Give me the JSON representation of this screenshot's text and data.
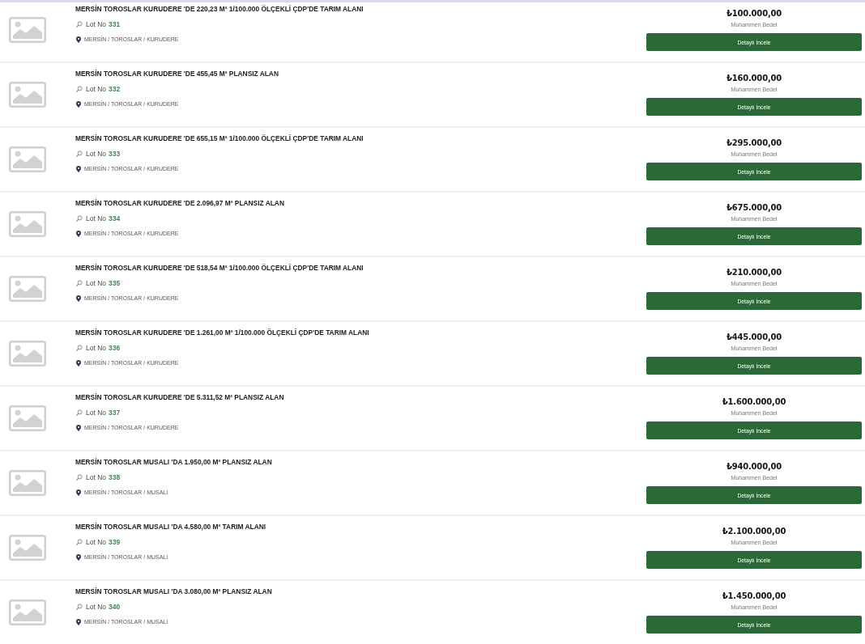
{
  "listings": [
    {
      "title": "MERSİN TOROSLAR KURUDERE 'DE 220,23 M² 1/100.000 ÖLÇEKLİ ÇDP'DE TARIM ALANI",
      "lot_label": "Lot No",
      "lot_number": "331",
      "location": "MERSİN / TOROSLAR / KURUDERE",
      "price": "₺100.000,00",
      "price_label": "Muhammen Bedel",
      "button": "Detaylı İncele"
    },
    {
      "title": "MERSİN TOROSLAR KURUDERE 'DE 455,45 M² PLANSIZ ALAN",
      "lot_label": "Lot No",
      "lot_number": "332",
      "location": "MERSİN / TOROSLAR / KURUDERE",
      "price": "₺160.000,00",
      "price_label": "Muhammen Bedel",
      "button": "Detaylı İncele"
    },
    {
      "title": "MERSİN TOROSLAR KURUDERE 'DE 655,15 M² 1/100.000 ÖLÇEKLİ ÇDP'DE TARIM ALANI",
      "lot_label": "Lot No",
      "lot_number": "333",
      "location": "MERSİN / TOROSLAR / KURUDERE",
      "price": "₺295.000,00",
      "price_label": "Muhammen Bedel",
      "button": "Detaylı İncele"
    },
    {
      "title": "MERSİN TOROSLAR KURUDERE 'DE 2.096,97 M² PLANSIZ ALAN",
      "lot_label": "Lot No",
      "lot_number": "334",
      "location": "MERSİN / TOROSLAR / KURUDERE",
      "price": "₺675.000,00",
      "price_label": "Muhammen Bedel",
      "button": "Detaylı İncele"
    },
    {
      "title": "MERSİN TOROSLAR KURUDERE 'DE 518,54 M² 1/100.000 ÖLÇEKLİ ÇDP'DE TARIM ALANI",
      "lot_label": "Lot No",
      "lot_number": "335",
      "location": "MERSİN / TOROSLAR / KURUDERE",
      "price": "₺210.000,00",
      "price_label": "Muhammen Bedel",
      "button": "Detaylı İncele"
    },
    {
      "title": "MERSİN TOROSLAR KURUDERE 'DE 1.261,00 M² 1/100.000 ÖLÇEKLİ ÇDP'DE TARIM ALANI",
      "lot_label": "Lot No",
      "lot_number": "336",
      "location": "MERSİN / TOROSLAR / KURUDERE",
      "price": "₺445.000,00",
      "price_label": "Muhammen Bedel",
      "button": "Detaylı İncele"
    },
    {
      "title": "MERSİN TOROSLAR KURUDERE 'DE 5.311,52 M² PLANSIZ ALAN",
      "lot_label": "Lot No",
      "lot_number": "337",
      "location": "MERSİN / TOROSLAR / KURUDERE",
      "price": "₺1.600.000,00",
      "price_label": "Muhammen Bedel",
      "button": "Detaylı İncele"
    },
    {
      "title": "MERSİN TOROSLAR MUSALI 'DA 1.950,00 M² PLANSIZ ALAN",
      "lot_label": "Lot No",
      "lot_number": "338",
      "location": "MERSİN / TOROSLAR / MUSALI",
      "price": "₺940.000,00",
      "price_label": "Muhammen Bedel",
      "button": "Detaylı İncele"
    },
    {
      "title": "MERSİN TOROSLAR MUSALI 'DA 4.580,00 M² TARIM ALANI",
      "lot_label": "Lot No",
      "lot_number": "339",
      "location": "MERSİN / TOROSLAR / MUSALI",
      "price": "₺2.100.000,00",
      "price_label": "Muhammen Bedel",
      "button": "Detaylı İncele"
    },
    {
      "title": "MERSİN TOROSLAR MUSALI 'DA 3.080,00 M² PLANSIZ ALAN",
      "lot_label": "Lot No",
      "lot_number": "340",
      "location": "MERSİN / TOROSLAR / MUSALI",
      "price": "₺1.450.000,00",
      "price_label": "Muhammen Bedel",
      "button": "Detaylı İncele"
    }
  ]
}
